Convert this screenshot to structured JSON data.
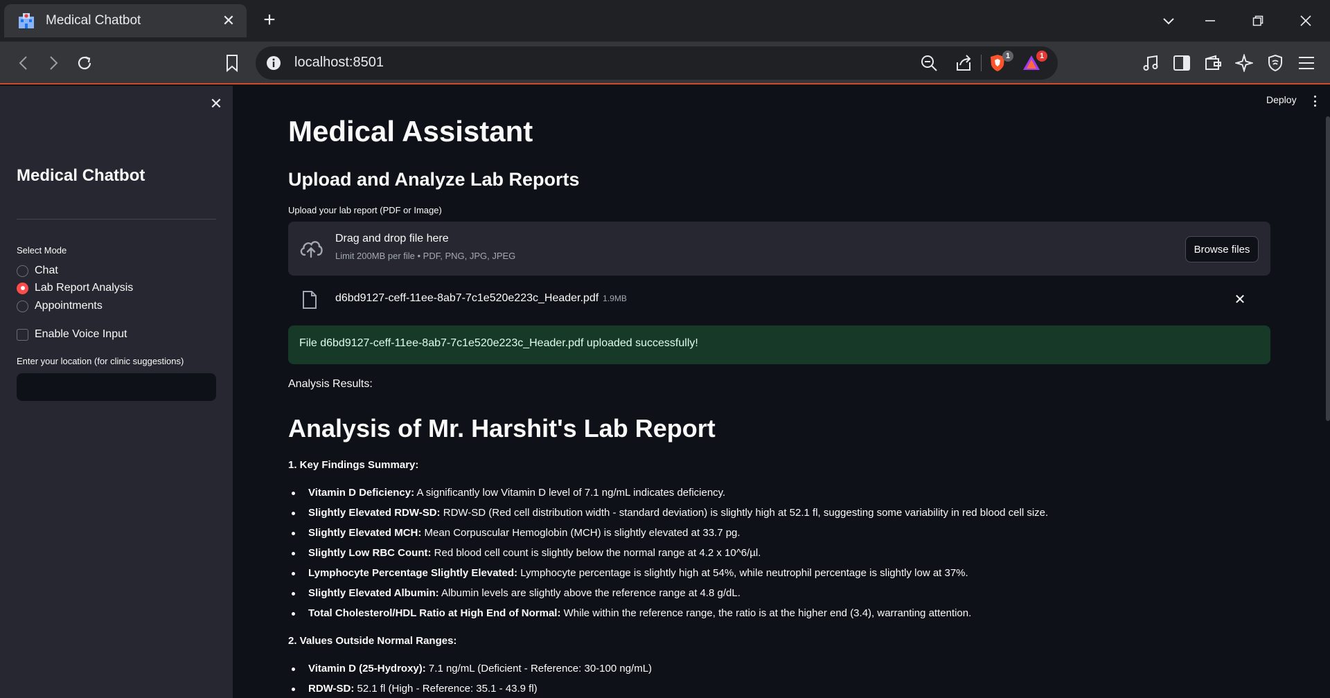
{
  "browser": {
    "tab_title": "Medical Chatbot",
    "url": "localhost:8501",
    "brave_badge": "1",
    "rewards_badge": "1"
  },
  "sidebar": {
    "title": "Medical Chatbot",
    "mode_label": "Select Mode",
    "modes": [
      {
        "label": "Chat",
        "selected": false
      },
      {
        "label": "Lab Report Analysis",
        "selected": true
      },
      {
        "label": "Appointments",
        "selected": false
      }
    ],
    "voice_label": "Enable Voice Input",
    "voice_checked": false,
    "location_label": "Enter your location (for clinic suggestions)",
    "location_value": ""
  },
  "header": {
    "deploy_label": "Deploy"
  },
  "main": {
    "title": "Medical Assistant",
    "subtitle": "Upload and Analyze Lab Reports",
    "upload_label": "Upload your lab report (PDF or Image)",
    "dropzone_text": "Drag and drop file here",
    "dropzone_limit": "Limit 200MB per file • PDF, PNG, JPG, JPEG",
    "browse_label": "Browse files",
    "file_name": "d6bd9127-ceff-11ee-8ab7-7c1e520e223c_Header.pdf",
    "file_size": "1.9MB",
    "success_message": "File d6bd9127-ceff-11ee-8ab7-7c1e520e223c_Header.pdf uploaded successfully!",
    "results_label": "Analysis Results:",
    "analysis_title": "Analysis of Mr. Harshit's Lab Report",
    "section1": "1. Key Findings Summary:",
    "findings": [
      {
        "bold": "Vitamin D Deficiency:",
        "text": " A significantly low Vitamin D level of 7.1 ng/mL indicates deficiency."
      },
      {
        "bold": "Slightly Elevated RDW-SD:",
        "text": " RDW-SD (Red cell distribution width - standard deviation) is slightly high at 52.1 fl, suggesting some variability in red blood cell size."
      },
      {
        "bold": "Slightly Elevated MCH:",
        "text": " Mean Corpuscular Hemoglobin (MCH) is slightly elevated at 33.7 pg."
      },
      {
        "bold": "Slightly Low RBC Count:",
        "text": " Red blood cell count is slightly below the normal range at 4.2 x 10^6/µl."
      },
      {
        "bold": "Lymphocyte Percentage Slightly Elevated:",
        "text": " Lymphocyte percentage is slightly high at 54%, while neutrophil percentage is slightly low at 37%."
      },
      {
        "bold": "Slightly Elevated Albumin:",
        "text": " Albumin levels are slightly above the reference range at 4.8 g/dL."
      },
      {
        "bold": "Total Cholesterol/HDL Ratio at High End of Normal:",
        "text": " While within the reference range, the ratio is at the higher end (3.4), warranting attention."
      }
    ],
    "section2": "2. Values Outside Normal Ranges:",
    "outside": [
      {
        "bold": "Vitamin D (25-Hydroxy):",
        "text": " 7.1 ng/mL (Deficient - Reference: 30-100 ng/mL)"
      },
      {
        "bold": "RDW-SD:",
        "text": " 52.1 fl (High - Reference: 35.1 - 43.9 fl)"
      }
    ]
  }
}
